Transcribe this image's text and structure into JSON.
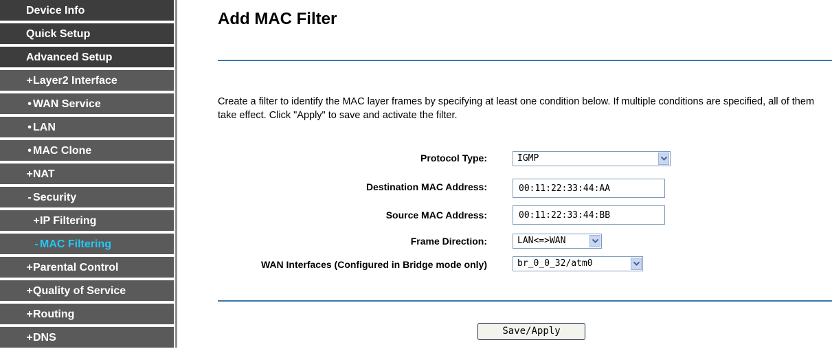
{
  "sidebar": {
    "items": [
      {
        "label": "Device Info",
        "bullet": "",
        "level": "top",
        "active": false
      },
      {
        "label": "Quick Setup",
        "bullet": "",
        "level": "top",
        "active": false
      },
      {
        "label": "Advanced Setup",
        "bullet": "",
        "level": "top",
        "active": false
      },
      {
        "label": "Layer2 Interface",
        "bullet": "+",
        "level": "lvl1",
        "active": false
      },
      {
        "label": "WAN Service",
        "bullet": "•",
        "level": "lvl1",
        "active": false
      },
      {
        "label": "LAN",
        "bullet": "•",
        "level": "lvl1",
        "active": false
      },
      {
        "label": "MAC Clone",
        "bullet": "•",
        "level": "lvl1",
        "active": false
      },
      {
        "label": "NAT",
        "bullet": "+",
        "level": "lvl1",
        "active": false
      },
      {
        "label": "Security",
        "bullet": "-",
        "level": "lvl1",
        "active": false
      },
      {
        "label": "IP Filtering",
        "bullet": "+",
        "level": "lvl2",
        "active": false
      },
      {
        "label": "MAC Filtering",
        "bullet": "-",
        "level": "lvl2",
        "active": true
      },
      {
        "label": "Parental Control",
        "bullet": "+",
        "level": "lvl1",
        "active": false
      },
      {
        "label": "Quality of Service",
        "bullet": "+",
        "level": "lvl1",
        "active": false
      },
      {
        "label": "Routing",
        "bullet": "+",
        "level": "lvl1",
        "active": false
      },
      {
        "label": "DNS",
        "bullet": "+",
        "level": "lvl1",
        "active": false
      }
    ],
    "active_color": "#26c6f5"
  },
  "main": {
    "title": "Add MAC Filter",
    "description": "Create a filter to identify the MAC layer frames by specifying at least one condition below. If multiple conditions are specified, all of them take effect. Click \"Apply\" to save and activate the filter.",
    "form": {
      "protocol_type": {
        "label": "Protocol Type:",
        "value": "IGMP"
      },
      "dest_mac": {
        "label": "Destination MAC Address:",
        "value": "00:11:22:33:44:AA"
      },
      "src_mac": {
        "label": "Source MAC Address:",
        "value": "00:11:22:33:44:BB"
      },
      "frame_direction": {
        "label": "Frame Direction:",
        "value": "LAN<=>WAN"
      },
      "wan_interfaces": {
        "label": "WAN Interfaces (Configured in Bridge mode only)",
        "value": "br_0_0_32/atm0"
      }
    },
    "save_label": "Save/Apply",
    "rule_color": "#3a77a8"
  }
}
